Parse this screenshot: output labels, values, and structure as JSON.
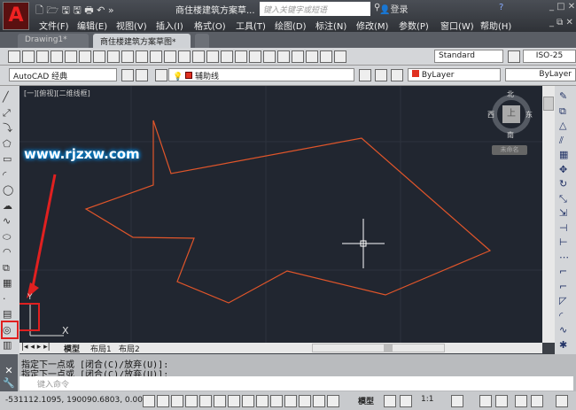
{
  "app": {
    "logo": "A",
    "doc_title": "商住楼建筑方案草...",
    "search_placeholder": "键入关键字或短语",
    "login": "登录"
  },
  "quick_access": [
    "new-icon",
    "open-icon",
    "save-icon",
    "saveas-icon",
    "print-icon",
    "undo-icon"
  ],
  "menu": [
    "文件(F)",
    "编辑(E)",
    "视图(V)",
    "插入(I)",
    "格式(O)",
    "工具(T)",
    "绘图(D)",
    "标注(N)",
    "修改(M)",
    "参数(P)",
    "窗口(W)",
    "帮助(H)"
  ],
  "tabs": [
    {
      "label": "Drawing1*",
      "active": false
    },
    {
      "label": "商住楼建筑方案草图*",
      "active": true
    }
  ],
  "toolbar": {
    "text_style": "Standard",
    "dim_style": "ISO-25",
    "workspace": "AutoCAD 经典",
    "layer": "辅助线",
    "color": "ByLayer",
    "linetype": "ByLayer",
    "layer_color": "#e03020"
  },
  "viewport": {
    "label": "[一][俯视][二维线框]",
    "watermark": "www.rjzxw.com",
    "viewcube": {
      "north": "北",
      "south": "南",
      "east": "东",
      "west": "西",
      "top": "上",
      "wcs": "未命名"
    },
    "ucs_y": "Y",
    "ucs_x": "X",
    "shape_color": "#e0552a"
  },
  "layout_tabs": [
    "模型",
    "布局1",
    "布局2"
  ],
  "command": {
    "history": [
      "指定下一点或 [闭合(C)/放弃(U)]:",
      "指定下一点或 [闭合(C)/放弃(U)]:"
    ],
    "placeholder": "键入命令"
  },
  "status": {
    "coords": "-531112.1095, 190090.6803, 0.0000",
    "model": "模型",
    "scale": "1:1"
  }
}
